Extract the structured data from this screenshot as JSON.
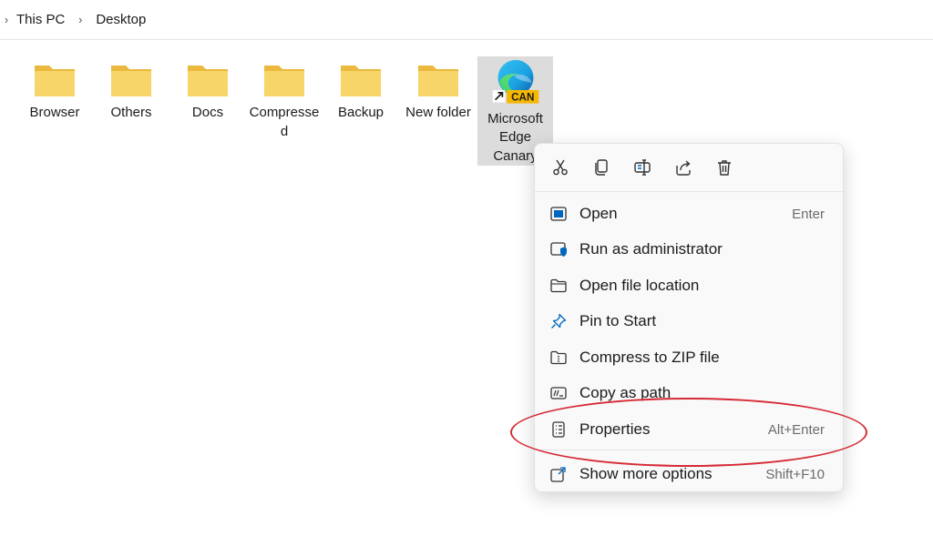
{
  "breadcrumb": {
    "items": [
      "This PC",
      "Desktop"
    ]
  },
  "files": [
    {
      "label": "Browser",
      "icon": "folder-icon"
    },
    {
      "label": "Others",
      "icon": "folder-icon"
    },
    {
      "label": "Docs",
      "icon": "folder-icon"
    },
    {
      "label": "Compressed",
      "icon": "folder-icon"
    },
    {
      "label": "Backup",
      "icon": "folder-icon"
    },
    {
      "label": "New folder",
      "icon": "folder-icon"
    },
    {
      "label": "Microsoft Edge Canary",
      "icon": "edge-canary-icon",
      "badge": "CAN",
      "selected": true
    }
  ],
  "context_menu": {
    "quick_actions": [
      "cut-icon",
      "copy-icon",
      "rename-icon",
      "share-icon",
      "delete-icon"
    ],
    "items": [
      {
        "label": "Open",
        "shortcut": "Enter",
        "icon": "open-window-icon"
      },
      {
        "label": "Run as administrator",
        "shortcut": "",
        "icon": "shield-window-icon"
      },
      {
        "label": "Open file location",
        "shortcut": "",
        "icon": "folder-outline-icon"
      },
      {
        "label": "Pin to Start",
        "shortcut": "",
        "icon": "pin-icon"
      },
      {
        "label": "Compress to ZIP file",
        "shortcut": "",
        "icon": "zip-icon"
      },
      {
        "label": "Copy as path",
        "shortcut": "",
        "icon": "path-icon"
      },
      {
        "label": "Properties",
        "shortcut": "Alt+Enter",
        "icon": "properties-icon"
      },
      {
        "label": "Show more options",
        "shortcut": "Shift+F10",
        "icon": "more-options-icon"
      }
    ]
  },
  "colors": {
    "folder": "#f8d568",
    "folder_dark": "#eab93d",
    "annotation": "#d62a35",
    "accent": "#0067c0"
  }
}
